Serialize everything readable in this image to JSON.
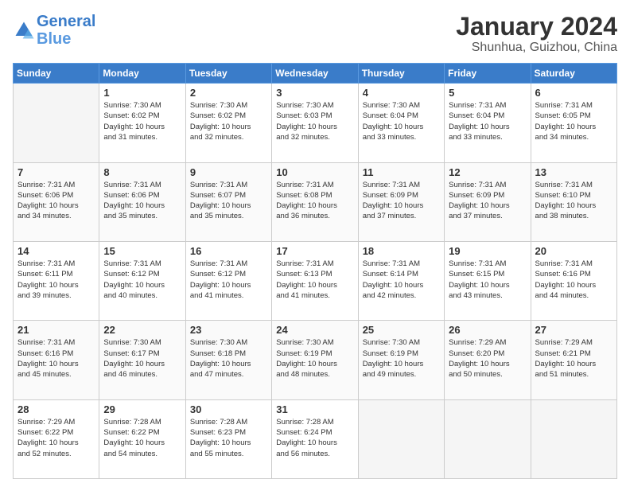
{
  "header": {
    "logo_line1": "General",
    "logo_line2": "Blue",
    "title": "January 2024",
    "subtitle": "Shunhua, Guizhou, China"
  },
  "days_of_week": [
    "Sunday",
    "Monday",
    "Tuesday",
    "Wednesday",
    "Thursday",
    "Friday",
    "Saturday"
  ],
  "weeks": [
    [
      {
        "day": "",
        "info": ""
      },
      {
        "day": "1",
        "info": "Sunrise: 7:30 AM\nSunset: 6:02 PM\nDaylight: 10 hours\nand 31 minutes."
      },
      {
        "day": "2",
        "info": "Sunrise: 7:30 AM\nSunset: 6:02 PM\nDaylight: 10 hours\nand 32 minutes."
      },
      {
        "day": "3",
        "info": "Sunrise: 7:30 AM\nSunset: 6:03 PM\nDaylight: 10 hours\nand 32 minutes."
      },
      {
        "day": "4",
        "info": "Sunrise: 7:30 AM\nSunset: 6:04 PM\nDaylight: 10 hours\nand 33 minutes."
      },
      {
        "day": "5",
        "info": "Sunrise: 7:31 AM\nSunset: 6:04 PM\nDaylight: 10 hours\nand 33 minutes."
      },
      {
        "day": "6",
        "info": "Sunrise: 7:31 AM\nSunset: 6:05 PM\nDaylight: 10 hours\nand 34 minutes."
      }
    ],
    [
      {
        "day": "7",
        "info": "Sunrise: 7:31 AM\nSunset: 6:06 PM\nDaylight: 10 hours\nand 34 minutes."
      },
      {
        "day": "8",
        "info": "Sunrise: 7:31 AM\nSunset: 6:06 PM\nDaylight: 10 hours\nand 35 minutes."
      },
      {
        "day": "9",
        "info": "Sunrise: 7:31 AM\nSunset: 6:07 PM\nDaylight: 10 hours\nand 35 minutes."
      },
      {
        "day": "10",
        "info": "Sunrise: 7:31 AM\nSunset: 6:08 PM\nDaylight: 10 hours\nand 36 minutes."
      },
      {
        "day": "11",
        "info": "Sunrise: 7:31 AM\nSunset: 6:09 PM\nDaylight: 10 hours\nand 37 minutes."
      },
      {
        "day": "12",
        "info": "Sunrise: 7:31 AM\nSunset: 6:09 PM\nDaylight: 10 hours\nand 37 minutes."
      },
      {
        "day": "13",
        "info": "Sunrise: 7:31 AM\nSunset: 6:10 PM\nDaylight: 10 hours\nand 38 minutes."
      }
    ],
    [
      {
        "day": "14",
        "info": "Sunrise: 7:31 AM\nSunset: 6:11 PM\nDaylight: 10 hours\nand 39 minutes."
      },
      {
        "day": "15",
        "info": "Sunrise: 7:31 AM\nSunset: 6:12 PM\nDaylight: 10 hours\nand 40 minutes."
      },
      {
        "day": "16",
        "info": "Sunrise: 7:31 AM\nSunset: 6:12 PM\nDaylight: 10 hours\nand 41 minutes."
      },
      {
        "day": "17",
        "info": "Sunrise: 7:31 AM\nSunset: 6:13 PM\nDaylight: 10 hours\nand 41 minutes."
      },
      {
        "day": "18",
        "info": "Sunrise: 7:31 AM\nSunset: 6:14 PM\nDaylight: 10 hours\nand 42 minutes."
      },
      {
        "day": "19",
        "info": "Sunrise: 7:31 AM\nSunset: 6:15 PM\nDaylight: 10 hours\nand 43 minutes."
      },
      {
        "day": "20",
        "info": "Sunrise: 7:31 AM\nSunset: 6:16 PM\nDaylight: 10 hours\nand 44 minutes."
      }
    ],
    [
      {
        "day": "21",
        "info": "Sunrise: 7:31 AM\nSunset: 6:16 PM\nDaylight: 10 hours\nand 45 minutes."
      },
      {
        "day": "22",
        "info": "Sunrise: 7:30 AM\nSunset: 6:17 PM\nDaylight: 10 hours\nand 46 minutes."
      },
      {
        "day": "23",
        "info": "Sunrise: 7:30 AM\nSunset: 6:18 PM\nDaylight: 10 hours\nand 47 minutes."
      },
      {
        "day": "24",
        "info": "Sunrise: 7:30 AM\nSunset: 6:19 PM\nDaylight: 10 hours\nand 48 minutes."
      },
      {
        "day": "25",
        "info": "Sunrise: 7:30 AM\nSunset: 6:19 PM\nDaylight: 10 hours\nand 49 minutes."
      },
      {
        "day": "26",
        "info": "Sunrise: 7:29 AM\nSunset: 6:20 PM\nDaylight: 10 hours\nand 50 minutes."
      },
      {
        "day": "27",
        "info": "Sunrise: 7:29 AM\nSunset: 6:21 PM\nDaylight: 10 hours\nand 51 minutes."
      }
    ],
    [
      {
        "day": "28",
        "info": "Sunrise: 7:29 AM\nSunset: 6:22 PM\nDaylight: 10 hours\nand 52 minutes."
      },
      {
        "day": "29",
        "info": "Sunrise: 7:28 AM\nSunset: 6:22 PM\nDaylight: 10 hours\nand 54 minutes."
      },
      {
        "day": "30",
        "info": "Sunrise: 7:28 AM\nSunset: 6:23 PM\nDaylight: 10 hours\nand 55 minutes."
      },
      {
        "day": "31",
        "info": "Sunrise: 7:28 AM\nSunset: 6:24 PM\nDaylight: 10 hours\nand 56 minutes."
      },
      {
        "day": "",
        "info": ""
      },
      {
        "day": "",
        "info": ""
      },
      {
        "day": "",
        "info": ""
      }
    ]
  ]
}
